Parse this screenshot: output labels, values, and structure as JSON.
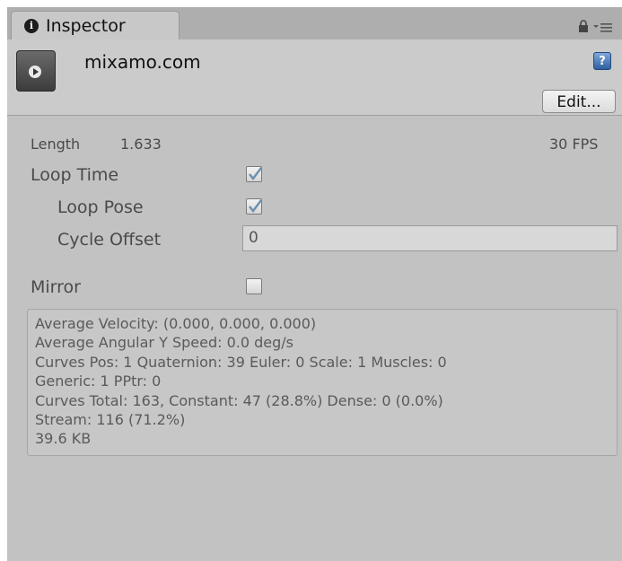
{
  "tab": {
    "label": "Inspector",
    "icon": "info-icon"
  },
  "header": {
    "asset_name": "mixamo.com",
    "asset_icon": "animation-clip-icon",
    "edit_label": "Edit...",
    "help_icon_text": "?"
  },
  "clip": {
    "length_label": "Length",
    "length_value": "1.633",
    "fps": "30 FPS",
    "loop_time_label": "Loop Time",
    "loop_time_checked": true,
    "loop_pose_label": "Loop Pose",
    "loop_pose_checked": true,
    "cycle_offset_label": "Cycle Offset",
    "cycle_offset_value": "0",
    "mirror_label": "Mirror",
    "mirror_checked": false
  },
  "info": {
    "lines": [
      "Average Velocity: (0.000, 0.000, 0.000)",
      "Average Angular Y Speed: 0.0 deg/s",
      "Curves Pos: 1 Quaternion: 39 Euler: 0 Scale: 1 Muscles: 0",
      "Generic: 1 PPtr: 0",
      "Curves Total: 163, Constant: 47 (28.8%) Dense: 0 (0.0%)",
      "Stream: 116 (71.2%)",
      "39.6 KB"
    ]
  },
  "colors": {
    "panel_bg": "#c2c2c2",
    "checkmark": "#6f8fae"
  }
}
